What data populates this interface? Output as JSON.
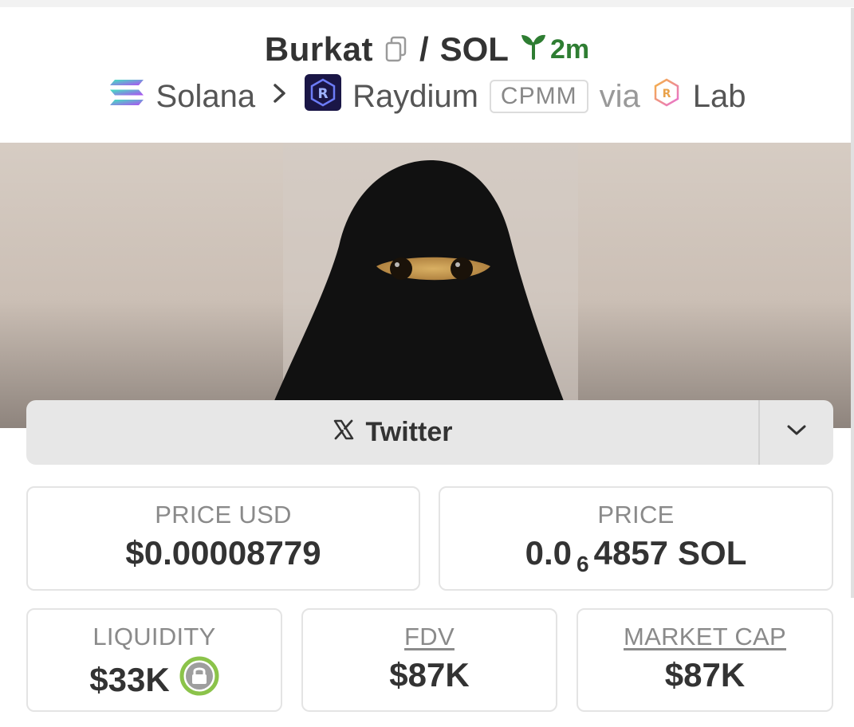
{
  "header": {
    "token_name": "Burkat",
    "separator": "/",
    "quote_symbol": "SOL",
    "age": "2m",
    "icons": {
      "copy": "copy-icon",
      "age": "seedling-icon"
    }
  },
  "chain_row": {
    "chain": "Solana",
    "dex": "Raydium",
    "pool_type": "CPMM",
    "via": "via",
    "launchpad": "Lab",
    "icons": {
      "chain": "solana-logo-icon",
      "separator": "chevron-right-icon",
      "dex": "raydium-logo-icon",
      "launchpad": "raydium-lab-logo-icon"
    }
  },
  "banner": {
    "alt": "token-banner-image"
  },
  "social": {
    "twitter_label": "Twitter",
    "icons": {
      "twitter": "x-logo-icon",
      "more": "chevron-down-icon"
    }
  },
  "stats": {
    "price_usd": {
      "label": "PRICE USD",
      "value": "$0.00008779"
    },
    "price": {
      "label": "PRICE",
      "prefix": "0.0",
      "zeros": "6",
      "digits": "4857",
      "unit": "SOL"
    },
    "liquidity": {
      "label": "LIQUIDITY",
      "value": "$33K"
    },
    "fdv": {
      "label": "FDV",
      "value": "$87K"
    },
    "market_cap": {
      "label": "MARKET CAP",
      "value": "$87K"
    }
  },
  "colors": {
    "age_green": "#2e7d32",
    "lock_green": "#8bc34a",
    "social_bg": "#e7e7e7",
    "card_border": "#e4e4e4"
  }
}
